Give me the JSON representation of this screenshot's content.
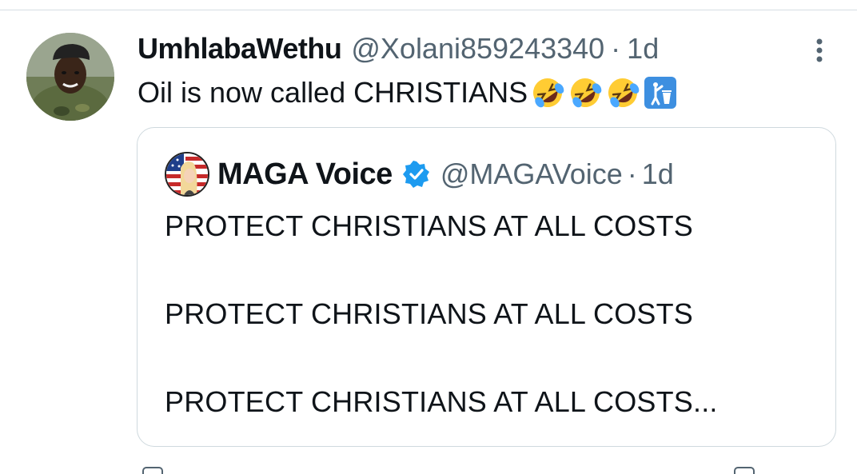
{
  "tweet": {
    "display_name": "UmhlabaWethu",
    "handle": "@Xolani859243340",
    "separator": "·",
    "time": "1d",
    "text": "Oil is now called CHRISTIANS",
    "emojis": [
      "rolling-on-floor-laughing",
      "rolling-on-floor-laughing",
      "rolling-on-floor-laughing",
      "litter-in-bin-sign"
    ]
  },
  "quote": {
    "display_name": "MAGA Voice",
    "handle": "@MAGAVoice",
    "separator": "·",
    "time": "1d",
    "verified": true,
    "lines": [
      "PROTECT CHRISTIANS AT ALL COSTS",
      "PROTECT CHRISTIANS AT ALL COSTS",
      "PROTECT CHRISTIANS AT ALL COSTS..."
    ]
  },
  "colors": {
    "text": "#0f1419",
    "secondary": "#536471",
    "border": "#cfd9de",
    "verified": "#1d9bf0"
  }
}
